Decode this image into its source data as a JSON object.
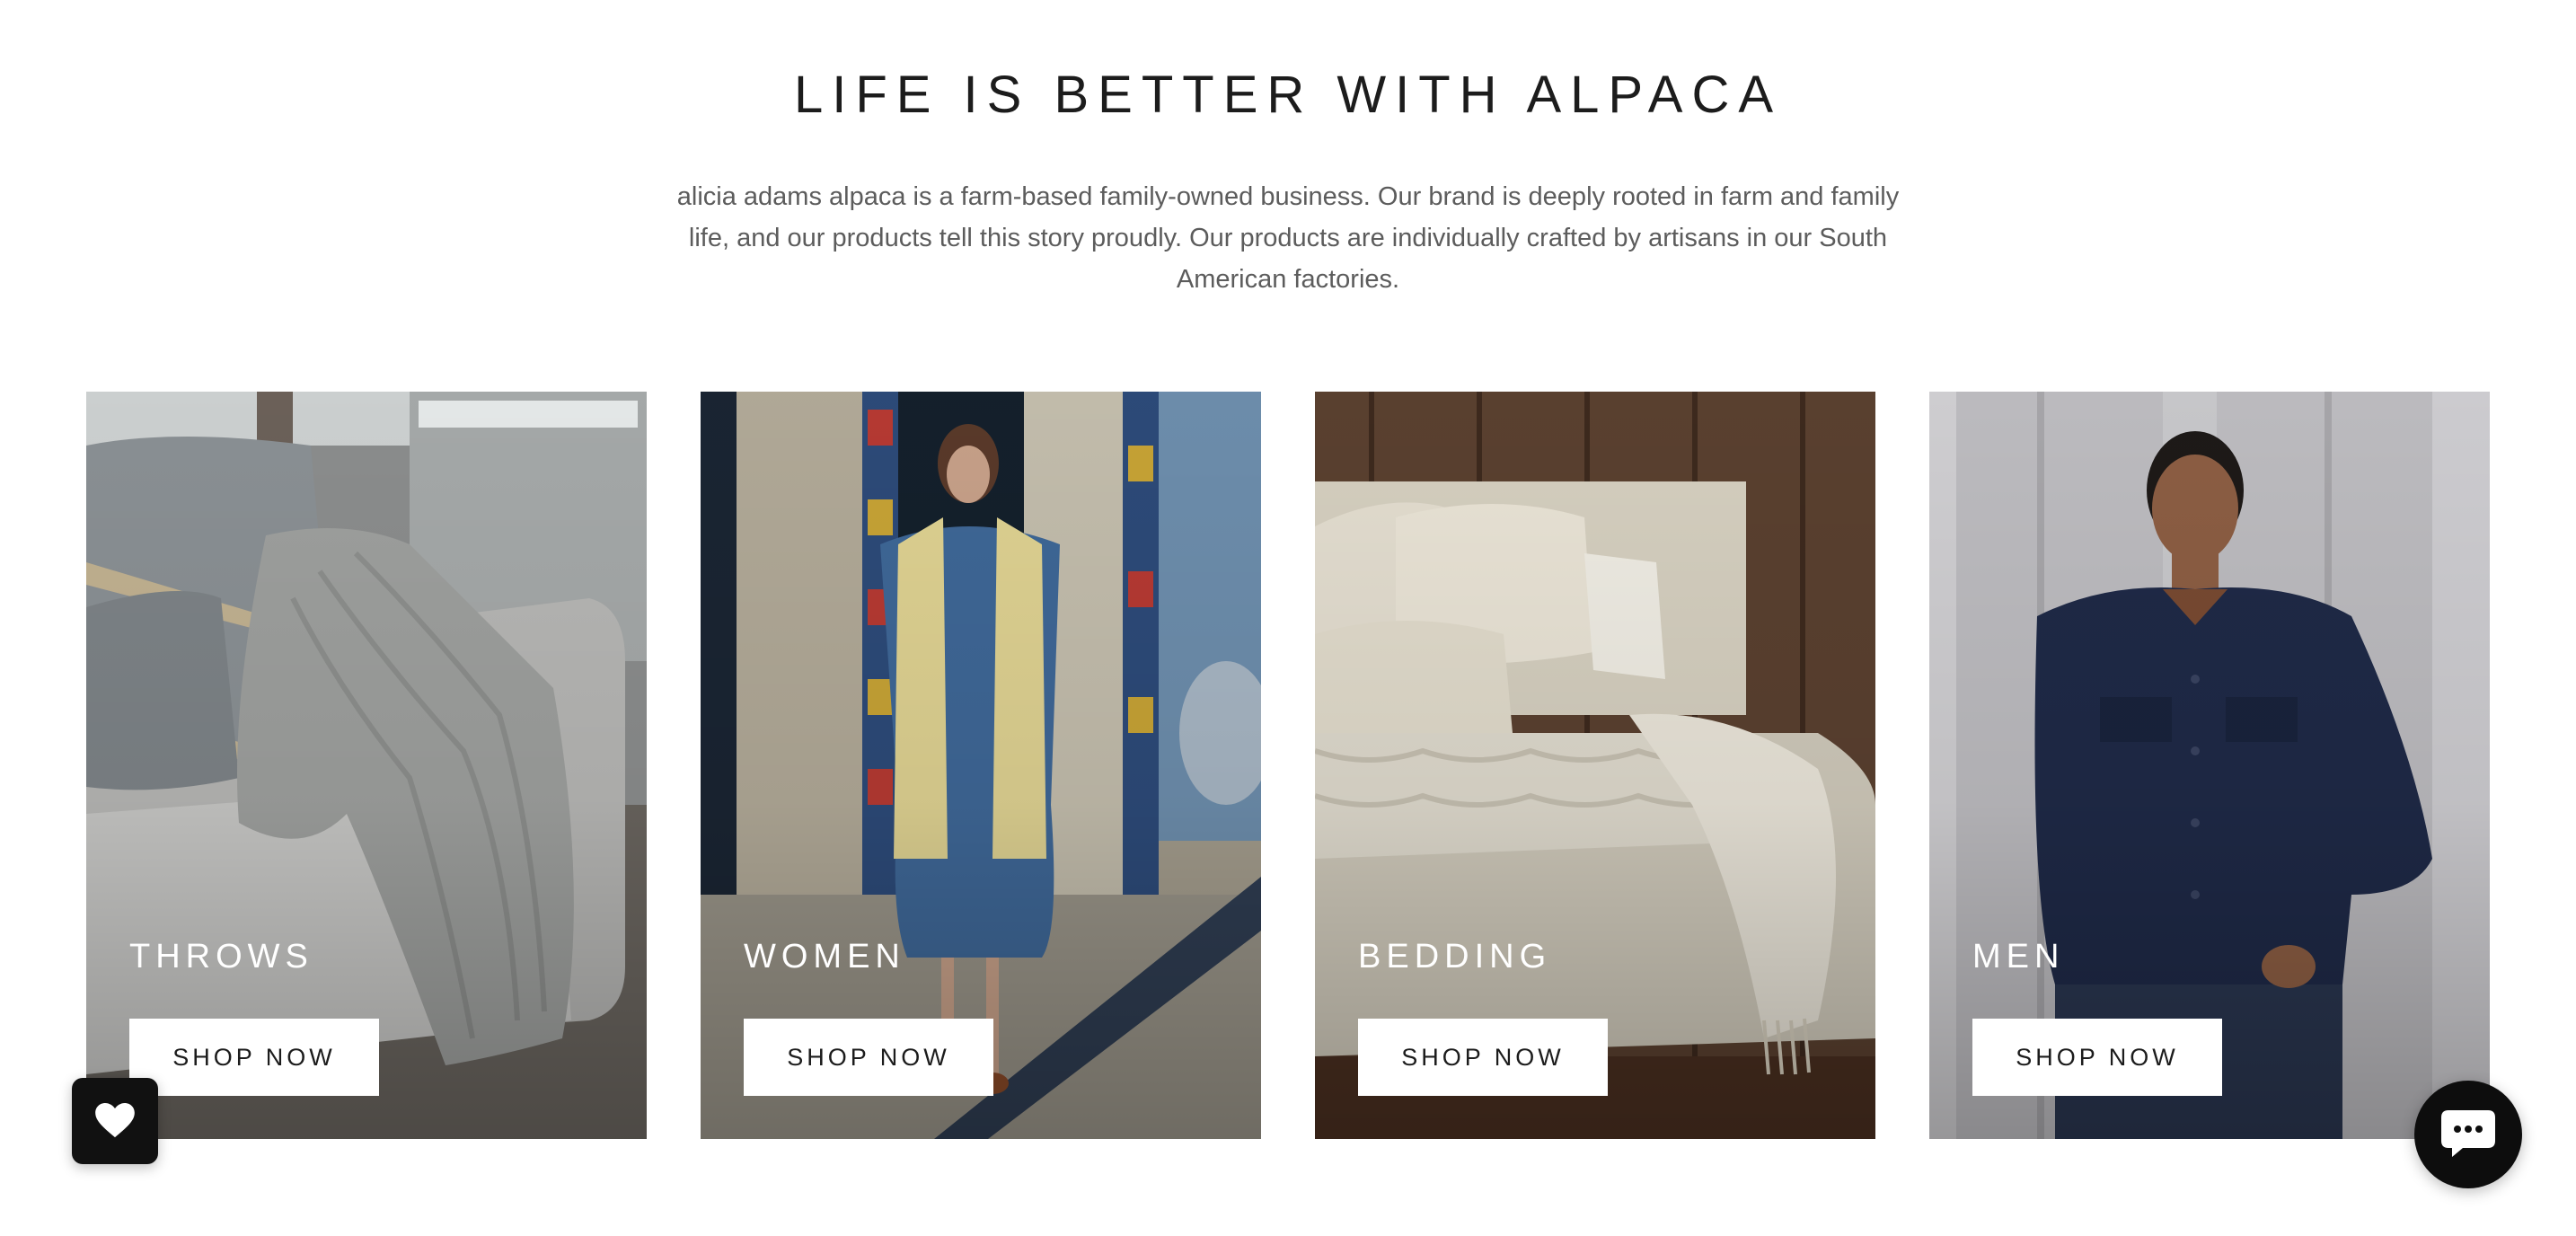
{
  "intro": {
    "title": "LIFE IS BETTER WITH ALPACA",
    "description": "alicia adams alpaca is a farm-based family-owned business. Our brand is deeply rooted in farm and family life, and our products tell this story proudly. Our products are individually crafted by artisans in our South American factories."
  },
  "categories": [
    {
      "label": "THROWS",
      "button": "SHOP NOW"
    },
    {
      "label": "WOMEN",
      "button": "SHOP NOW"
    },
    {
      "label": "BEDDING",
      "button": "SHOP NOW"
    },
    {
      "label": "MEN",
      "button": "SHOP NOW"
    }
  ],
  "floating": {
    "wishlist_icon": "heart-icon",
    "chat_icon": "chat-bubble-icon"
  },
  "colors": {
    "button_bg": "#ffffff",
    "text": "#1c1c1c",
    "floating_bg": "#111111"
  }
}
